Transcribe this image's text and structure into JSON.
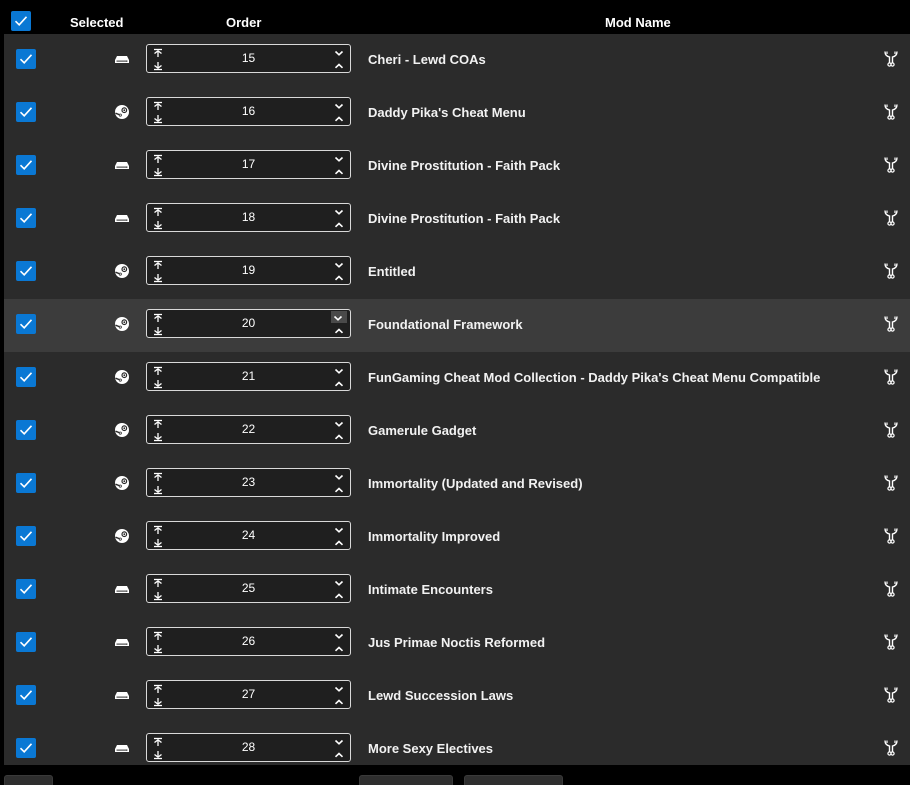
{
  "header": {
    "selected_label": "Selected",
    "order_label": "Order",
    "modname_label": "Mod Name",
    "select_all_checked": true
  },
  "colors": {
    "accent": "#0a78d4",
    "row_bg": "#2b2b2b",
    "row_hover_bg": "#3c3c3c"
  },
  "rows": [
    {
      "selected": true,
      "source": "local-drive-icon",
      "order": "15",
      "name": "Cheri - Lewd COAs"
    },
    {
      "selected": true,
      "source": "steam-icon",
      "order": "16",
      "name": "Daddy Pika's Cheat Menu"
    },
    {
      "selected": true,
      "source": "local-drive-icon",
      "order": "17",
      "name": "Divine Prostitution - Faith Pack"
    },
    {
      "selected": true,
      "source": "local-drive-icon",
      "order": "18",
      "name": "Divine Prostitution - Faith Pack"
    },
    {
      "selected": true,
      "source": "steam-icon",
      "order": "19",
      "name": "Entitled"
    },
    {
      "selected": true,
      "source": "steam-icon",
      "order": "20",
      "name": "Foundational Framework",
      "hovered": true
    },
    {
      "selected": true,
      "source": "steam-icon",
      "order": "21",
      "name": "FunGaming Cheat Mod Collection - Daddy Pika's Cheat Menu Compatible"
    },
    {
      "selected": true,
      "source": "steam-icon",
      "order": "22",
      "name": "Gamerule Gadget"
    },
    {
      "selected": true,
      "source": "steam-icon",
      "order": "23",
      "name": "Immortality (Updated and Revised)"
    },
    {
      "selected": true,
      "source": "steam-icon",
      "order": "24",
      "name": "Immortality Improved"
    },
    {
      "selected": true,
      "source": "local-drive-icon",
      "order": "25",
      "name": "Intimate Encounters"
    },
    {
      "selected": true,
      "source": "local-drive-icon",
      "order": "26",
      "name": "Jus Primae Noctis Reformed"
    },
    {
      "selected": true,
      "source": "local-drive-icon",
      "order": "27",
      "name": "Lewd Succession Laws"
    },
    {
      "selected": true,
      "source": "local-drive-icon",
      "order": "28",
      "name": "More Sexy Electives"
    }
  ]
}
